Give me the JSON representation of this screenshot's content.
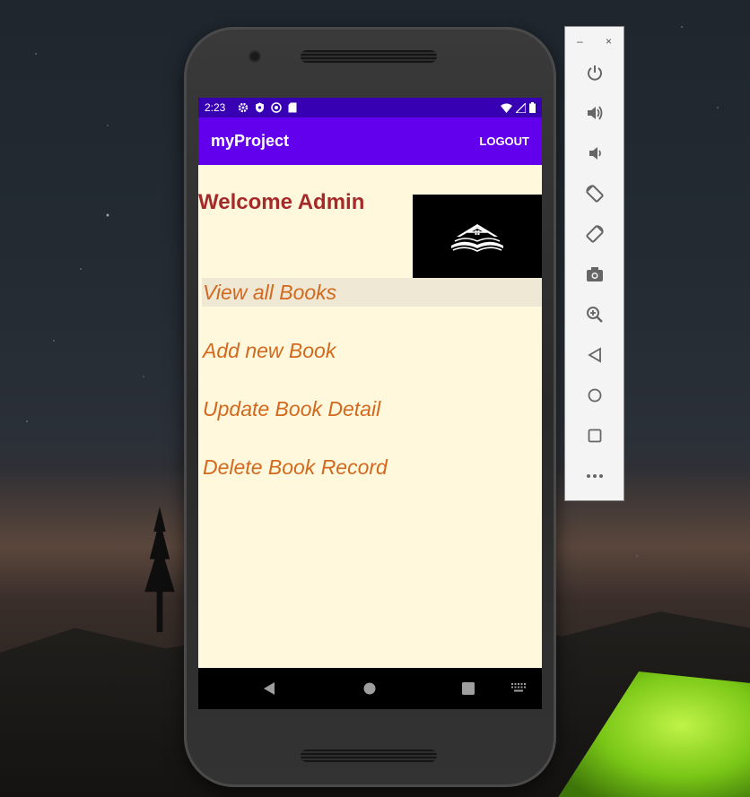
{
  "status_bar": {
    "time": "2:23",
    "left_icons": [
      "settings-icon",
      "shield-icon",
      "sync-icon",
      "sd-card-icon"
    ],
    "right_icons": [
      "wifi-icon",
      "signal-icon",
      "battery-icon"
    ]
  },
  "app_bar": {
    "title": "myProject",
    "logout_label": "LOGOUT"
  },
  "content": {
    "welcome_text": "Welcome Admin",
    "logo": "book-house-logo-icon",
    "menu": [
      {
        "label": "View all Books",
        "selected": true
      },
      {
        "label": "Add new Book",
        "selected": false
      },
      {
        "label": "Update Book Detail",
        "selected": false
      },
      {
        "label": "Delete Book Record",
        "selected": false
      }
    ]
  },
  "nav_bar": {
    "buttons": [
      "back-icon",
      "home-icon",
      "recents-icon",
      "keyboard-icon"
    ]
  },
  "emulator_panel": {
    "window_controls": [
      "minimize-icon",
      "close-icon"
    ],
    "tools": [
      "power-icon",
      "volume-up-icon",
      "volume-down-icon",
      "rotate-left-icon",
      "rotate-right-icon",
      "screenshot-icon",
      "zoom-icon",
      "back-icon",
      "home-icon",
      "overview-icon",
      "more-icon"
    ]
  },
  "colors": {
    "status_bar": "#3700b3",
    "app_bar": "#6200ee",
    "screen_bg": "#fff8dc",
    "welcome_text": "#a52a2a",
    "menu_text": "#d2691e",
    "selected_row": "#eee8d4"
  }
}
